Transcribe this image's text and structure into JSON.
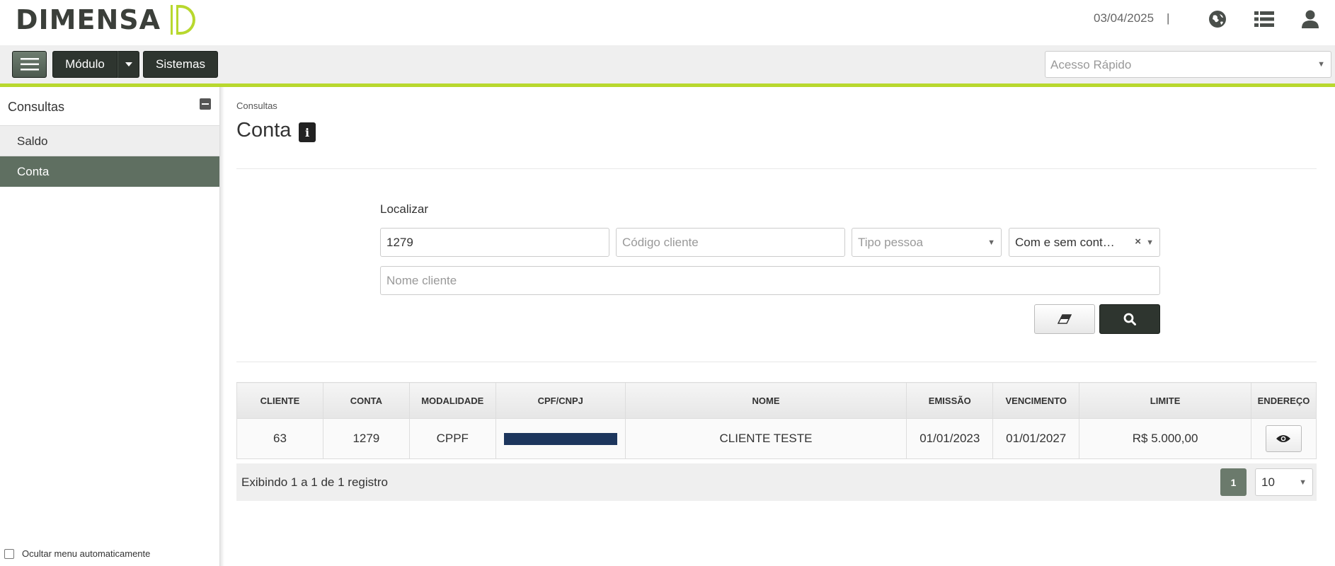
{
  "header": {
    "brand": "DIMENSA",
    "date": "03/04/2025",
    "separator": "|",
    "icons": [
      "globe-icon",
      "list-icon",
      "user-icon"
    ]
  },
  "toolbar": {
    "modulo_label": "Módulo",
    "sistemas_label": "Sistemas",
    "quick_access_placeholder": "Acesso Rápido"
  },
  "sidebar": {
    "title": "Consultas",
    "items": [
      {
        "label": "Saldo",
        "active": false
      },
      {
        "label": "Conta",
        "active": true
      }
    ],
    "auto_hide_label": "Ocultar menu automaticamente"
  },
  "main": {
    "breadcrumb": "Consultas",
    "title": "Conta",
    "search": {
      "label": "Localizar",
      "account_value": "1279",
      "client_code_placeholder": "Código cliente",
      "person_type_placeholder": "Tipo pessoa",
      "contract_filter_value": "Com e sem cont…",
      "client_name_placeholder": "Nome cliente"
    },
    "table": {
      "headers": [
        "CLIENTE",
        "CONTA",
        "MODALIDADE",
        "CPF/CNPJ",
        "NOME",
        "EMISSÃO",
        "VENCIMENTO",
        "LIMITE",
        "ENDEREÇO"
      ],
      "rows": [
        {
          "cliente": "63",
          "conta": "1279",
          "modalidade": "CPPF",
          "cpf_cnpj": "",
          "nome": "CLIENTE TESTE",
          "emissao": "01/01/2023",
          "vencimento": "01/01/2027",
          "limite": "R$ 5.000,00"
        }
      ]
    },
    "footer": {
      "summary": "Exibindo 1 a 1 de 1 registro",
      "current_page": "1",
      "page_size": "10"
    }
  },
  "colors": {
    "accent_line": "#b8d82e",
    "dark_button": "#2e352f",
    "active_sidebar": "#5f6f61",
    "redaction": "#1d365d"
  }
}
